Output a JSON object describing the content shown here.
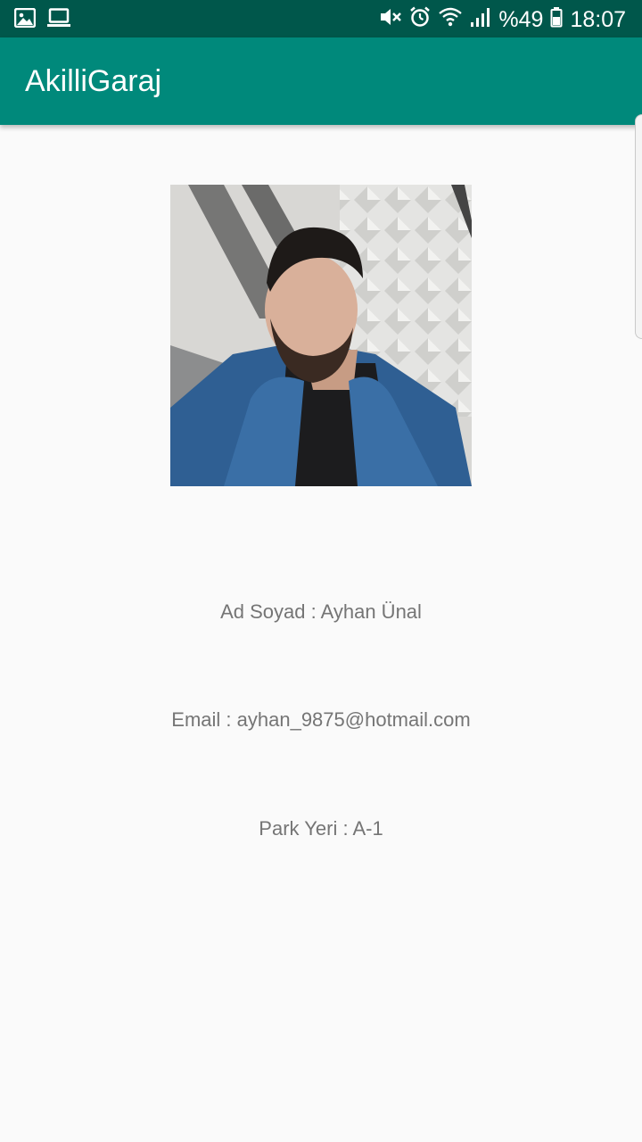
{
  "status_bar": {
    "icons_left": [
      "image-icon",
      "laptop-icon"
    ],
    "icons_right": [
      "mute-icon",
      "alarm-icon",
      "wifi-icon",
      "signal-icon"
    ],
    "battery_text": "%49",
    "time": "18:07"
  },
  "app_bar": {
    "title": "AkilliGaraj",
    "color": "#00897b",
    "status_color": "#00574b"
  },
  "profile": {
    "photo_icon": "profile-photo",
    "name_line": "Ad Soyad : Ayhan Ünal",
    "email_line": "Email : ayhan_9875@hotmail.com",
    "parking_line": "Park Yeri : A-1"
  }
}
